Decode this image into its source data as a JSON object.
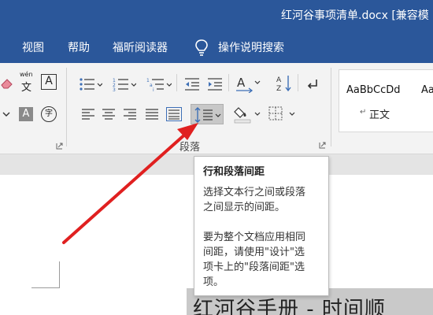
{
  "window": {
    "title": "红河谷事项清单.docx [兼容模"
  },
  "tabs": [
    {
      "label": "视图"
    },
    {
      "label": "帮助"
    },
    {
      "label": "福昕阅读器"
    },
    {
      "label": "操作说明搜索"
    }
  ],
  "font_group": {
    "phonetic_label": "wén",
    "phonetic_char": "文",
    "boxed_char": "A",
    "shaded_char": "A",
    "enclosed_char": "字"
  },
  "paragraph_group": {
    "label": "段落"
  },
  "styles": [
    {
      "sample": "AaBbCcDd",
      "name": "正文",
      "mark": "↵"
    },
    {
      "sample": "AaB"
    }
  ],
  "tooltip": {
    "title": "行和段落间距",
    "lines": [
      "选择文本行之间或段落",
      "之间显示的间距。",
      "",
      "要为整个文档应用相同",
      "间距，请使用\"设计\"选",
      "项卡上的\"段落间距\"选",
      "项。"
    ]
  },
  "document": {
    "heading": "红河谷手册 - 时间顺"
  },
  "colors": {
    "accent": "#2b579a",
    "ribbon_bg": "#f3f3f3",
    "arrow": "#e02020",
    "icon_blue": "#3d6fb6"
  }
}
